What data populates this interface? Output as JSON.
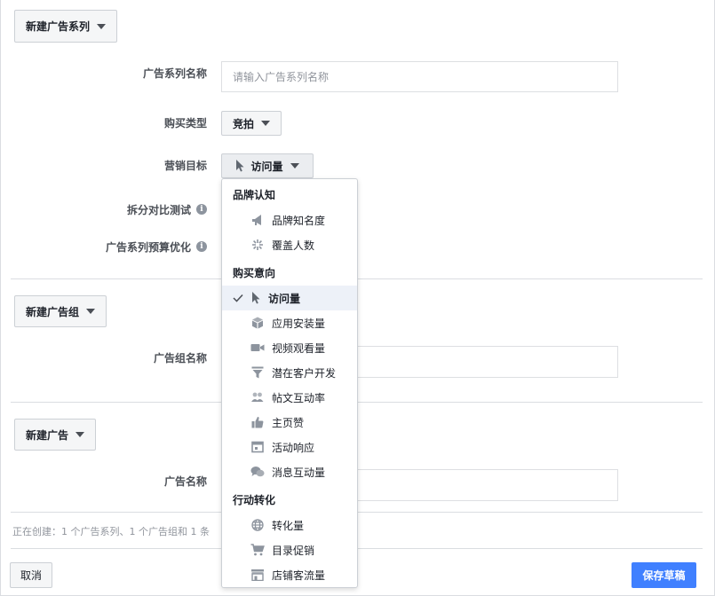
{
  "campaign": {
    "new_button": "新建广告系列",
    "name_label": "广告系列名称",
    "name_placeholder": "请输入广告系列名称",
    "buy_type_label": "购买类型",
    "buy_type_value": "竞拍",
    "objective_label": "营销目标",
    "objective_value": "访问量",
    "split_test_label": "拆分对比测试",
    "budget_opt_label": "广告系列预算优化"
  },
  "adset": {
    "new_button": "新建广告组",
    "name_label": "广告组名称"
  },
  "ad": {
    "new_button": "新建广告",
    "name_label": "广告名称"
  },
  "footer": {
    "creating_text": "正在创建：1 个广告系列、1 个广告组和 1 条",
    "cancel": "取消",
    "save_draft": "保存草稿"
  },
  "objective_menu": {
    "sections": [
      {
        "title": "品牌认知",
        "items": [
          {
            "label": "品牌知名度",
            "icon": "megaphone-icon"
          },
          {
            "label": "覆盖人数",
            "icon": "reach-icon"
          }
        ]
      },
      {
        "title": "购买意向",
        "items": [
          {
            "label": "访问量",
            "icon": "cursor-icon",
            "selected": true
          },
          {
            "label": "应用安装量",
            "icon": "box-icon"
          },
          {
            "label": "视频观看量",
            "icon": "video-camera-icon"
          },
          {
            "label": "潜在客户开发",
            "icon": "funnel-icon"
          },
          {
            "label": "帖文互动率",
            "icon": "people-icon"
          },
          {
            "label": "主页赞",
            "icon": "thumbs-up-icon"
          },
          {
            "label": "活动响应",
            "icon": "calendar-icon"
          },
          {
            "label": "消息互动量",
            "icon": "chat-bubbles-icon"
          }
        ]
      },
      {
        "title": "行动转化",
        "items": [
          {
            "label": "转化量",
            "icon": "globe-icon"
          },
          {
            "label": "目录促销",
            "icon": "cart-icon"
          },
          {
            "label": "店铺客流量",
            "icon": "store-icon"
          }
        ]
      }
    ]
  },
  "colors": {
    "primary": "#4080ff",
    "button_bg": "#f5f6f7",
    "border": "#ccd0d5",
    "selected_bg": "#edf1f8",
    "icon_gray": "#8d949e"
  }
}
